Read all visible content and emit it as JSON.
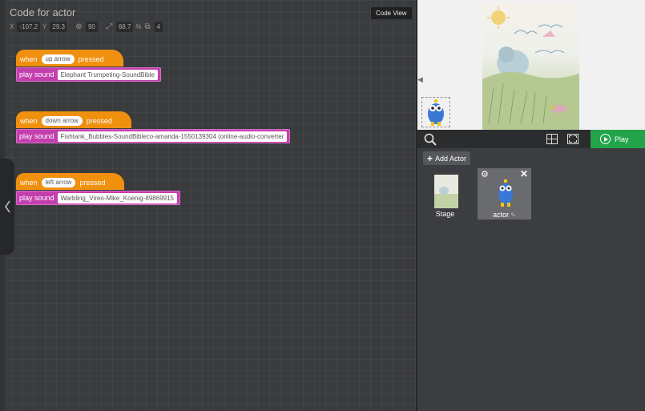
{
  "code_panel": {
    "title": "Code for actor",
    "code_view_label": "Code View",
    "props": {
      "x_label": "X",
      "x_value": "-107.2",
      "y_label": "Y",
      "y_value": "29.3",
      "rotation_value": "90",
      "scale_value": "68.7",
      "scale_unit": "%",
      "layer_value": "4"
    }
  },
  "scripts": [
    {
      "when": "when",
      "key": "up arrow",
      "pressed": "pressed",
      "action": "play sound",
      "sound": "Elephant Trumpeting-SoundBible"
    },
    {
      "when": "when",
      "key": "down arrow",
      "pressed": "pressed",
      "action": "play sound",
      "sound": "Fishtank_Bubbles-SoundBibleco-amanda-1550139304 (online-audio-converter"
    },
    {
      "when": "when",
      "key": "left arrow",
      "pressed": "pressed",
      "action": "play sound",
      "sound": "Warbling_Vireo-Mike_Koenig-89869915"
    }
  ],
  "toolbar": {
    "play_label": "Play"
  },
  "actors": {
    "add_label": "Add Actor",
    "stage_label": "Stage",
    "actor_label": "actor"
  },
  "colors": {
    "event_block": "#f0900f",
    "sound_block": "#c43fae",
    "play_button": "#22a54a"
  }
}
